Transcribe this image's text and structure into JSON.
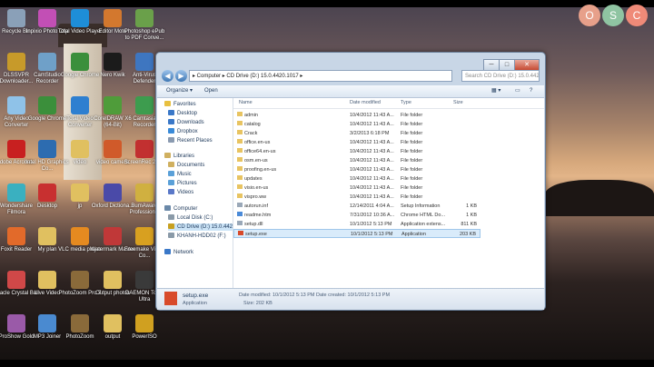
{
  "desktop": {
    "icons": [
      {
        "label": "Recycle Bin",
        "color": "#8aa0b8"
      },
      {
        "label": "Inpixio Photo Clip",
        "color": "#c24fb5"
      },
      {
        "label": "Total Video Player",
        "color": "#1e8ed8"
      },
      {
        "label": "Editor Moto",
        "color": "#d3782e"
      },
      {
        "label": "Photoshop ePub to PDF Conve...",
        "color": "#6aa04a"
      },
      {
        "label": "DLSSVPR Downloader...",
        "color": "#c79a2a"
      },
      {
        "label": "CamStudio Recorder",
        "color": "#6fa0c8"
      },
      {
        "label": "Google Chrome",
        "color": "#3b8f3b"
      },
      {
        "label": "Nero Kwik",
        "color": "#1b1b1b"
      },
      {
        "label": "Anti-Virus Defender",
        "color": "#3e76c0"
      },
      {
        "label": "Any Video Converter",
        "color": "#8fc2e8"
      },
      {
        "label": "Google Chrome",
        "color": "#3b8f3b"
      },
      {
        "label": "Total Video Converter",
        "color": "#2e7fd0"
      },
      {
        "label": "CorelDRAW X6 (64-Bit)",
        "color": "#4f9c3a"
      },
      {
        "label": "Camtasia Recorder",
        "color": "#3d9c4e"
      },
      {
        "label": "Adobe Acrobat...",
        "color": "#c82020"
      },
      {
        "label": "Intel HD Graphics Co...",
        "color": "#2d6cb0"
      },
      {
        "label": "video",
        "color": "#e0c060"
      },
      {
        "label": "video camera",
        "color": "#d05a2a"
      },
      {
        "label": "ScreenRec 2020",
        "color": "#c23030"
      },
      {
        "label": "Wondershare Filmora",
        "color": "#3ab0c0"
      },
      {
        "label": "Desktop",
        "color": "#c83030"
      },
      {
        "label": "jp",
        "color": "#e0c060"
      },
      {
        "label": "Oxford Dictiona...",
        "color": "#4a4aa8"
      },
      {
        "label": "BumAward Professional",
        "color": "#d0b040"
      },
      {
        "label": "Foxit Reader",
        "color": "#e26a2a"
      },
      {
        "label": "My plan",
        "color": "#e0c060"
      },
      {
        "label": "VLC media player",
        "color": "#e58a20"
      },
      {
        "label": "Watermark Master",
        "color": "#c03838"
      },
      {
        "label": "Freemake Video Co...",
        "color": "#d8a020"
      },
      {
        "label": "Oracle Crystal Ball",
        "color": "#d04848"
      },
      {
        "label": "Live Video",
        "color": "#e0c060"
      },
      {
        "label": "PhotoZoom Pro 7",
        "color": "#8a6a3a"
      },
      {
        "label": "Output photos",
        "color": "#e0c060"
      },
      {
        "label": "DAEMON Tools Ultra",
        "color": "#3a3a3a"
      },
      {
        "label": "ProShow Gold",
        "color": "#9a5aa8"
      },
      {
        "label": "MP3 Joiner",
        "color": "#4a8ad0"
      },
      {
        "label": "PhotoZoom",
        "color": "#8a6a3a"
      },
      {
        "label": "output",
        "color": "#e0c060"
      },
      {
        "label": "PowerISO",
        "color": "#d0a020"
      }
    ]
  },
  "logo": {
    "letters": [
      "O",
      "S",
      "C"
    ],
    "colors": [
      "#e7a08a",
      "#8fc4a2",
      "#ef8a78"
    ]
  },
  "window": {
    "controls": {
      "minimize": "─",
      "maximize": "□",
      "close": "✕"
    },
    "nav": {
      "back": "◀",
      "forward": "▶"
    },
    "address": "▸ Computer ▸ CD Drive (D:) 15.0.4420.1017 ▸",
    "search_placeholder": "Search CD Drive (D:) 15.0.442...",
    "toolbar": {
      "organize": "Organize ▾",
      "open": "Open"
    },
    "sidebar": [
      {
        "label": "Favorites",
        "color": "#e8c040"
      },
      {
        "label": "Desktop",
        "color": "#3a78c8"
      },
      {
        "label": "Downloads",
        "color": "#3a78c8"
      },
      {
        "label": "Dropbox",
        "color": "#3a8ad8"
      },
      {
        "label": "Recent Places",
        "color": "#8a9ab0"
      },
      {
        "label": "Libraries",
        "color": "#d0b060"
      },
      {
        "label": "Documents",
        "color": "#d0b060"
      },
      {
        "label": "Music",
        "color": "#5aa0d8"
      },
      {
        "label": "Pictures",
        "color": "#5aa0d8"
      },
      {
        "label": "Videos",
        "color": "#5a78c8"
      },
      {
        "label": "Computer",
        "color": "#6a88a8"
      },
      {
        "label": "Local Disk (C:)",
        "color": "#8a9aa8"
      },
      {
        "label": "CD Drive (D:) 15.0.442",
        "color": "#c8a020"
      },
      {
        "label": "KHANH-HDD02 (F:)",
        "color": "#8a9aa8"
      },
      {
        "label": "Network",
        "color": "#3a78c8"
      }
    ],
    "columns": {
      "name": "Name",
      "date": "Date modified",
      "type": "Type",
      "size": "Size"
    },
    "files": [
      {
        "name": "admin",
        "date": "10/4/2012 11:43 A...",
        "type": "File folder",
        "size": "",
        "icon": "#e8c462"
      },
      {
        "name": "catalog",
        "date": "10/4/2012 11:43 A...",
        "type": "File folder",
        "size": "",
        "icon": "#e8c462"
      },
      {
        "name": "Crack",
        "date": "3/2/2013 6:18 PM",
        "type": "File folder",
        "size": "",
        "icon": "#e8c462"
      },
      {
        "name": "office.en-us",
        "date": "10/4/2012 11:43 A...",
        "type": "File folder",
        "size": "",
        "icon": "#e8c462"
      },
      {
        "name": "office64.en-us",
        "date": "10/4/2012 11:43 A...",
        "type": "File folder",
        "size": "",
        "icon": "#e8c462"
      },
      {
        "name": "osm.en-us",
        "date": "10/4/2012 11:43 A...",
        "type": "File folder",
        "size": "",
        "icon": "#e8c462"
      },
      {
        "name": "proofing.en-us",
        "date": "10/4/2012 11:43 A...",
        "type": "File folder",
        "size": "",
        "icon": "#e8c462"
      },
      {
        "name": "updates",
        "date": "10/4/2012 11:43 A...",
        "type": "File folder",
        "size": "",
        "icon": "#e8c462"
      },
      {
        "name": "visio.en-us",
        "date": "10/4/2012 11:43 A...",
        "type": "File folder",
        "size": "",
        "icon": "#e8c462"
      },
      {
        "name": "vispro.ww",
        "date": "10/4/2012 11:43 A...",
        "type": "File folder",
        "size": "",
        "icon": "#e8c462"
      },
      {
        "name": "autorun.inf",
        "date": "12/14/2011 4:04 A...",
        "type": "Setup Information",
        "size": "1 KB",
        "icon": "#9aa8b8"
      },
      {
        "name": "readme.htm",
        "date": "7/31/2012 10:36 A...",
        "type": "Chrome HTML Do...",
        "size": "1 KB",
        "icon": "#4a8ad8"
      },
      {
        "name": "setup.dll",
        "date": "10/1/2012 5:13 PM",
        "type": "Application extens...",
        "size": "811 KB",
        "icon": "#9aa8b8"
      },
      {
        "name": "setup.exe",
        "date": "10/1/2012 5:13 PM",
        "type": "Application",
        "size": "203 KB",
        "icon": "#d84a2a"
      }
    ],
    "details": {
      "name": "setup.exe",
      "kind": "Application",
      "modified": "Date modified: 10/1/2012 5:13 PM",
      "created": "Date created: 10/1/2012 5:13 PM",
      "size": "Size: 202 KB"
    }
  }
}
